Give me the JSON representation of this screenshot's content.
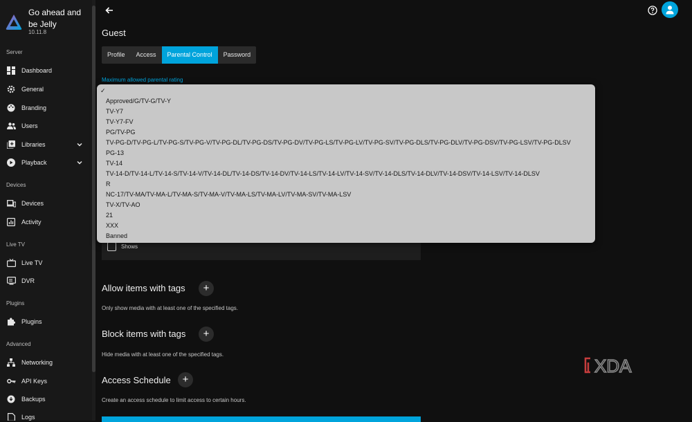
{
  "app": {
    "title": "Go ahead and be Jelly",
    "version": "10.11.8"
  },
  "sidebar": {
    "sections": [
      {
        "label": "Server",
        "items": [
          {
            "label": "Dashboard",
            "icon": "dashboard-icon"
          },
          {
            "label": "General",
            "icon": "gear-icon"
          },
          {
            "label": "Branding",
            "icon": "palette-icon"
          },
          {
            "label": "Users",
            "icon": "users-icon"
          },
          {
            "label": "Libraries",
            "icon": "library-icon",
            "expandable": true
          },
          {
            "label": "Playback",
            "icon": "play-icon",
            "expandable": true
          }
        ]
      },
      {
        "label": "Devices",
        "items": [
          {
            "label": "Devices",
            "icon": "devices-icon"
          },
          {
            "label": "Activity",
            "icon": "activity-icon"
          }
        ]
      },
      {
        "label": "Live TV",
        "items": [
          {
            "label": "Live TV",
            "icon": "tv-icon"
          },
          {
            "label": "DVR",
            "icon": "dvr-icon"
          }
        ]
      },
      {
        "label": "Plugins",
        "items": [
          {
            "label": "Plugins",
            "icon": "puzzle-icon"
          }
        ]
      },
      {
        "label": "Advanced",
        "items": [
          {
            "label": "Networking",
            "icon": "network-icon"
          },
          {
            "label": "API Keys",
            "icon": "key-icon"
          },
          {
            "label": "Backups",
            "icon": "backup-icon"
          },
          {
            "label": "Logs",
            "icon": "logs-icon"
          }
        ]
      }
    ]
  },
  "page": {
    "title": "Guest",
    "tabs": [
      {
        "label": "Profile",
        "active": false
      },
      {
        "label": "Access",
        "active": false
      },
      {
        "label": "Parental Control",
        "active": true
      },
      {
        "label": "Password",
        "active": false
      }
    ],
    "rating_label": "Maximum allowed parental rating",
    "block_checkbox_label": "Shows",
    "allow_tags_title": "Allow items with tags",
    "allow_tags_desc": "Only show media with at least one of the specified tags.",
    "block_tags_title": "Block items with tags",
    "block_tags_desc": "Hide media with at least one of the specified tags.",
    "schedule_title": "Access Schedule",
    "schedule_desc": "Create an access schedule to limit access to certain hours."
  },
  "dropdown": {
    "selected_mark": "✓",
    "options": [
      "Approved/G/TV-G/TV-Y",
      "TV-Y7",
      "TV-Y7-FV",
      "PG/TV-PG",
      "TV-PG-D/TV-PG-L/TV-PG-S/TV-PG-V/TV-PG-DL/TV-PG-DS/TV-PG-DV/TV-PG-LS/TV-PG-LV/TV-PG-SV/TV-PG-DLS/TV-PG-DLV/TV-PG-DSV/TV-PG-LSV/TV-PG-DLSV",
      "PG-13",
      "TV-14",
      "TV-14-D/TV-14-L/TV-14-S/TV-14-V/TV-14-DL/TV-14-DS/TV-14-DV/TV-14-LS/TV-14-LV/TV-14-SV/TV-14-DLS/TV-14-DLV/TV-14-DSV/TV-14-LSV/TV-14-DLSV",
      "R",
      "NC-17/TV-MA/TV-MA-L/TV-MA-S/TV-MA-V/TV-MA-LS/TV-MA-LV/TV-MA-SV/TV-MA-LSV",
      "TV-X/TV-AO",
      "21",
      "XXX",
      "Banned"
    ]
  },
  "watermark": {
    "text": "XDA"
  },
  "colors": {
    "accent": "#00a4dc",
    "background": "#101010",
    "sidebar": "#181818",
    "dropdown": "#c8c8c8"
  }
}
